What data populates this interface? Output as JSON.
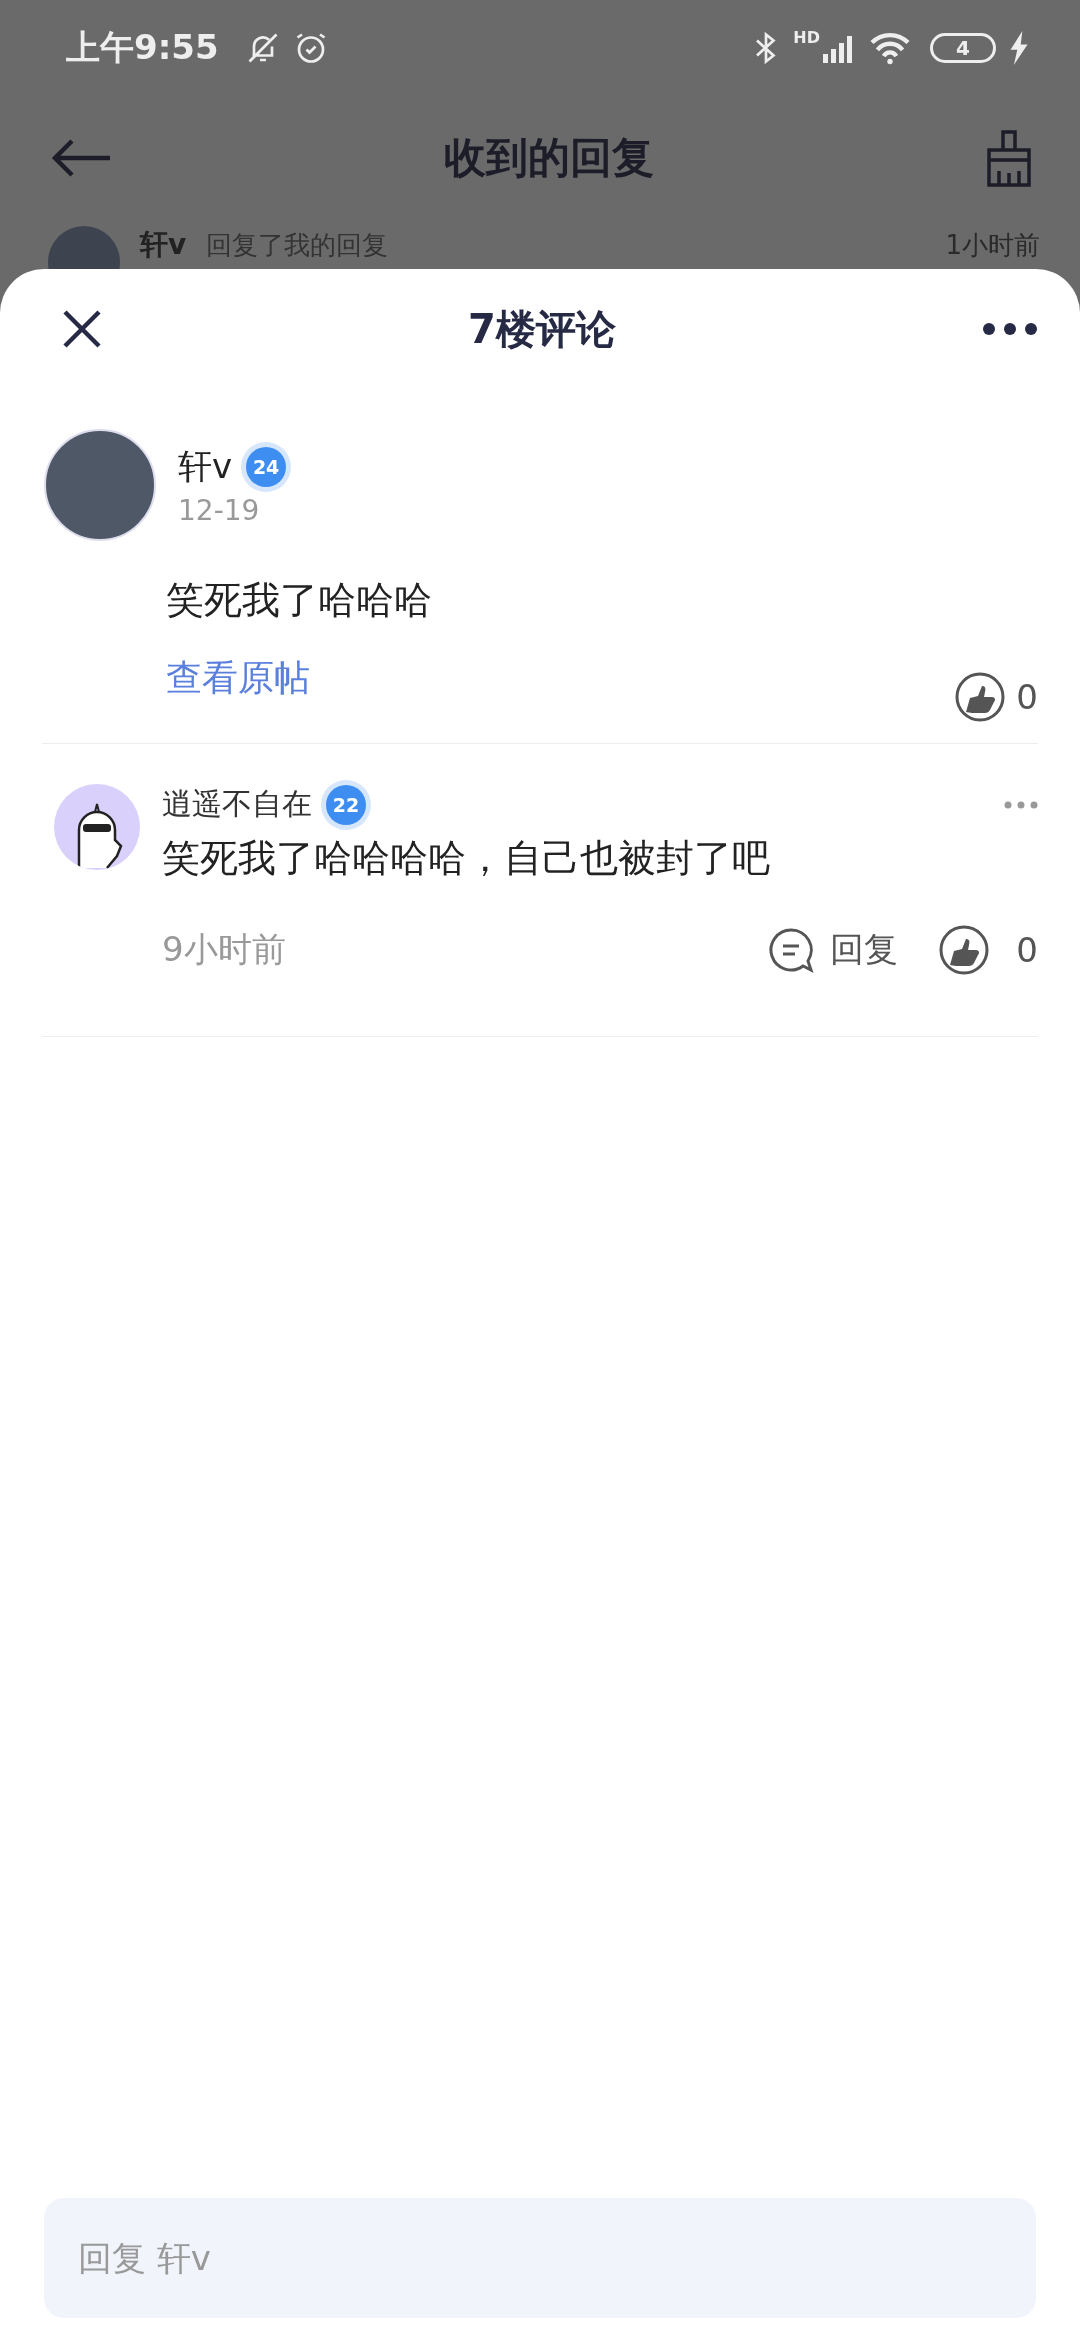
{
  "status_bar": {
    "time": "上午9:55",
    "network": "HD",
    "battery": "4"
  },
  "background_page": {
    "title": "收到的回复",
    "row": {
      "name": "轩v",
      "action": "回复了我的回复",
      "time": "1小时前"
    }
  },
  "sheet": {
    "title": "7楼评论",
    "comment": {
      "name": "轩v",
      "level": "24",
      "date": "12-19",
      "content": "笑死我了哈哈哈",
      "link": "查看原帖",
      "likes": "0"
    },
    "replies": [
      {
        "name": "逍遥不自在",
        "level": "22",
        "content": "笑死我了哈哈哈哈，自己也被封了吧",
        "time": "9小时前",
        "reply_label": "回复",
        "likes": "0"
      }
    ],
    "input": {
      "placeholder": "回复 轩v"
    }
  }
}
